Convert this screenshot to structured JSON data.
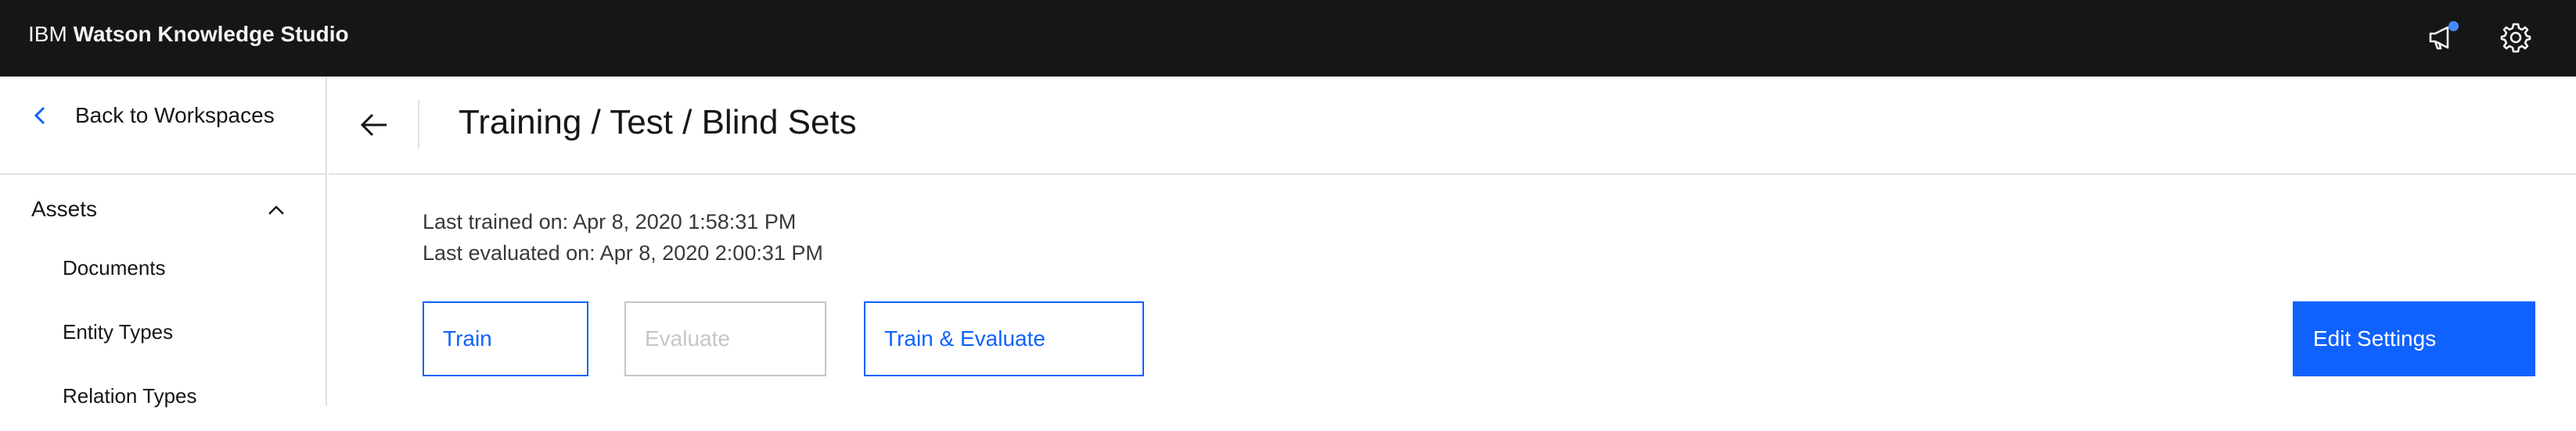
{
  "header": {
    "brand_prefix": "IBM",
    "brand_name": "Watson Knowledge Studio",
    "icons": [
      "megaphone-icon",
      "gear-icon"
    ],
    "notification_dot_color": "#4589ff"
  },
  "sidebar": {
    "back_label": "Back to Workspaces",
    "section_label": "Assets",
    "items": [
      {
        "label": "Documents"
      },
      {
        "label": "Entity Types"
      },
      {
        "label": "Relation Types"
      }
    ]
  },
  "main": {
    "title": "Training / Test / Blind Sets",
    "last_trained": "Last trained on: Apr 8, 2020 1:58:31 PM",
    "last_evaluated": "Last evaluated on: Apr 8, 2020 2:00:31 PM",
    "buttons": {
      "train": "Train",
      "evaluate": "Evaluate",
      "train_evaluate": "Train & Evaluate",
      "edit_settings": "Edit Settings"
    }
  },
  "colors": {
    "topbar": "#161616",
    "accent": "#0f62fe",
    "disabled": "#c6c6c6",
    "divider": "#e0e0e0"
  }
}
